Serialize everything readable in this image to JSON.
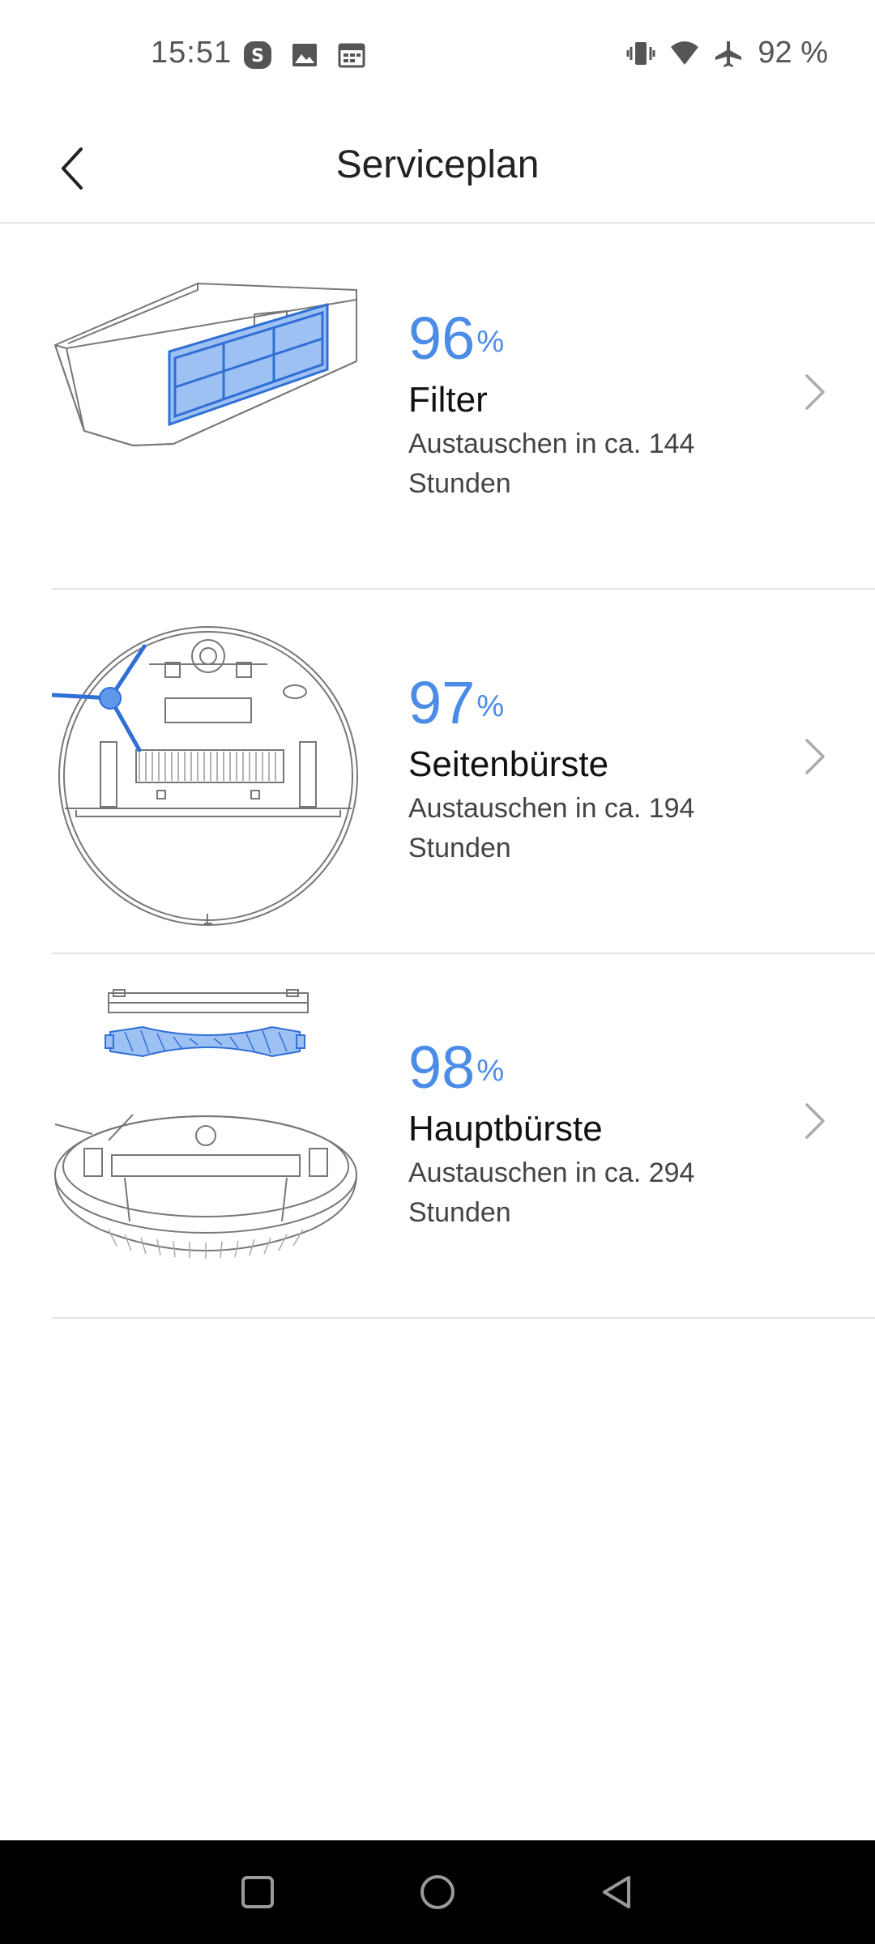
{
  "status_bar": {
    "time": "15:51",
    "battery": "92 %",
    "left_icons": [
      "s-app-icon",
      "gallery-icon",
      "calendar-icon"
    ],
    "right_icons": [
      "vibrate-icon",
      "wifi-icon",
      "airplane-icon"
    ]
  },
  "header": {
    "title": "Serviceplan",
    "back_icon": "chevron-left-icon"
  },
  "items": [
    {
      "percent": "96",
      "percent_sign": "%",
      "name": "Filter",
      "desc_line1": "Austauschen in ca. 144",
      "desc_line2": "Stunden",
      "image": "filter-illustration",
      "fill": 0.96
    },
    {
      "percent": "97",
      "percent_sign": "%",
      "name": "Seitenbürste",
      "desc_line1": "Austauschen in ca. 194",
      "desc_line2": "Stunden",
      "image": "side-brush-illustration",
      "fill": 0.97
    },
    {
      "percent": "98",
      "percent_sign": "%",
      "name": "Hauptbürste",
      "desc_line1": "Austauschen in ca. 294",
      "desc_line2": "Stunden",
      "image": "main-brush-illustration",
      "fill": 0.98
    }
  ],
  "colors": {
    "accent": "#4a8ce6",
    "divider": "#e3e3e3",
    "nav_bar": "#000000"
  },
  "nav_bar": {
    "buttons": [
      "recent-apps-icon",
      "home-icon",
      "back-icon"
    ]
  }
}
